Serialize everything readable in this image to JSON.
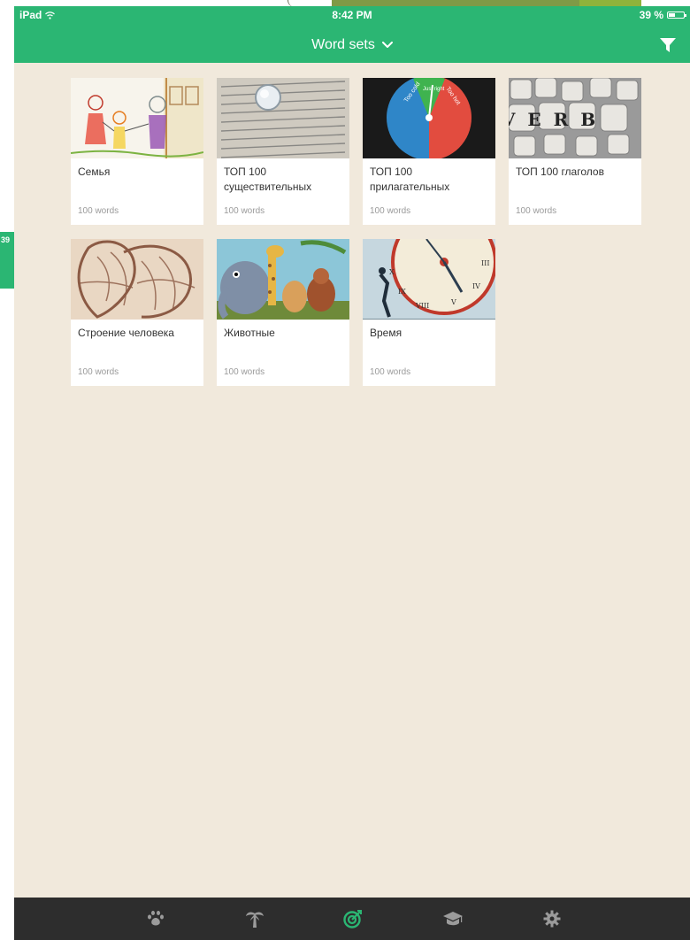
{
  "status": {
    "device": "iPad",
    "time": "8:42 PM",
    "battery": "39 %"
  },
  "side_badge": "39",
  "header": {
    "title": "Word sets"
  },
  "cards": [
    {
      "title": "Семья",
      "count": "100 words"
    },
    {
      "title": "ТОП 100 существительных",
      "count": "100 words"
    },
    {
      "title": "ТОП 100 прилагательных",
      "count": "100 words",
      "thumb_text": [
        "Too cold",
        "Just right",
        "Too hot"
      ]
    },
    {
      "title": "ТОП 100 глаголов",
      "count": "100 words",
      "thumb_text": "VERB"
    },
    {
      "title": "Строение человека",
      "count": "100 words"
    },
    {
      "title": "Животные",
      "count": "100 words"
    },
    {
      "title": "Время",
      "count": "100 words"
    }
  ],
  "tabs": [
    {
      "icon": "paw-icon"
    },
    {
      "icon": "palm-tree-icon"
    },
    {
      "icon": "target-icon",
      "active": true
    },
    {
      "icon": "graduation-cap-icon"
    },
    {
      "icon": "gear-icon"
    }
  ],
  "colors": {
    "accent": "#2bb673",
    "background": "#f1e9dc",
    "tabbar": "#2d2d2d",
    "tab_inactive": "#9b9b9b"
  }
}
